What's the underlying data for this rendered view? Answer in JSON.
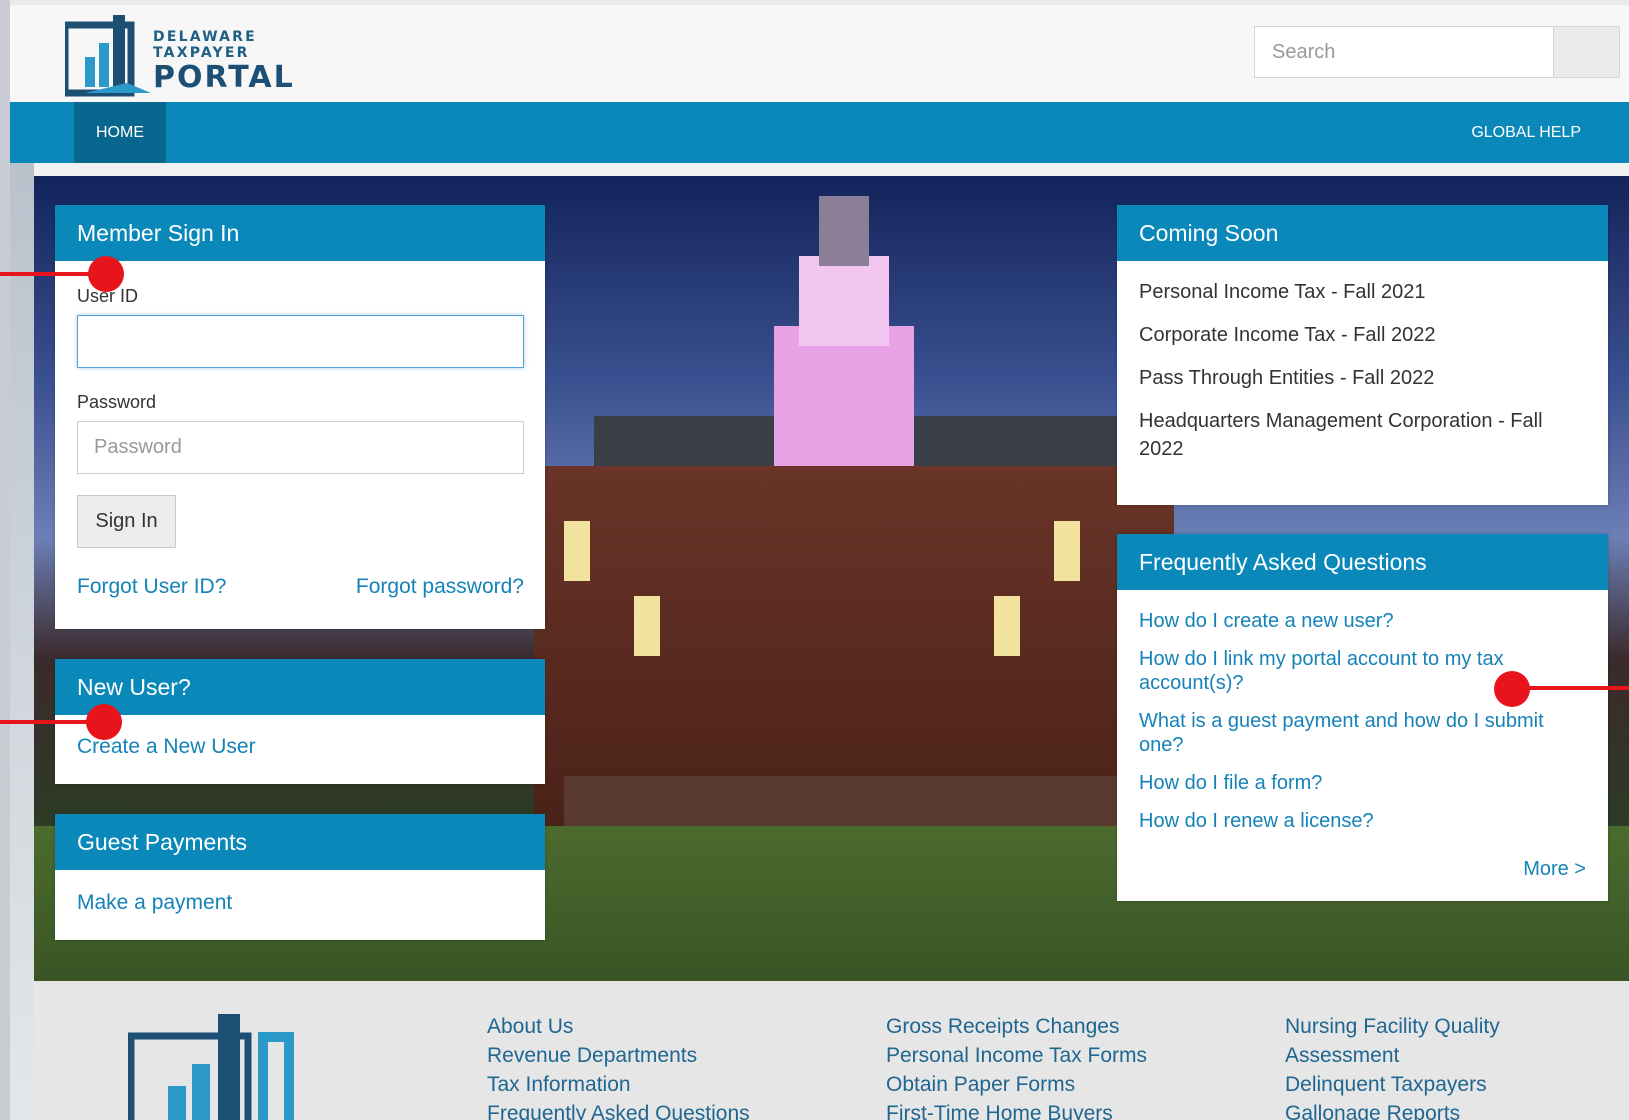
{
  "header": {
    "logo_line1": "DELAWARE",
    "logo_line2": "TAXPAYER",
    "logo_line3": "PORTAL",
    "search_placeholder": "Search"
  },
  "nav": {
    "home": "HOME",
    "global_help": "GLOBAL HELP"
  },
  "signin": {
    "title": "Member Sign In",
    "user_id_label": "User ID",
    "user_id_value": "",
    "password_label": "Password",
    "password_placeholder": "Password",
    "signin_button": "Sign In",
    "forgot_user_id": "Forgot User ID?",
    "forgot_password": "Forgot password?"
  },
  "new_user": {
    "title": "New User?",
    "link": "Create a New User"
  },
  "guest_payments": {
    "title": "Guest Payments",
    "link": "Make a payment"
  },
  "coming_soon": {
    "title": "Coming Soon",
    "items": [
      "Personal Income Tax - Fall 2021",
      "Corporate Income Tax - Fall 2022",
      "Pass Through Entities - Fall 2022",
      "Headquarters Management Corporation - Fall 2022"
    ]
  },
  "faq": {
    "title": "Frequently Asked Questions",
    "items": [
      "How do I create a new user?",
      "How do I link my portal account to my tax account(s)?",
      "What is a guest payment and how do I submit one?",
      "How do I file a form?",
      "How do I renew a license?"
    ],
    "more": "More >"
  },
  "footer": {
    "col1": [
      "About Us",
      "Revenue Departments",
      "Tax Information",
      "Frequently Asked Questions"
    ],
    "col2": [
      "Gross Receipts Changes",
      "Personal Income Tax Forms",
      "Obtain Paper Forms",
      "First-Time Home Buyers"
    ],
    "col3": [
      "Nursing Facility Quality",
      "Assessment",
      "Delinquent Taxpayers",
      "Gallonage Reports"
    ]
  },
  "colors": {
    "brand_blue": "#0a88b9",
    "brand_dark": "#07678f",
    "link_blue": "#1582b8",
    "annotation_red": "#e8141c"
  }
}
